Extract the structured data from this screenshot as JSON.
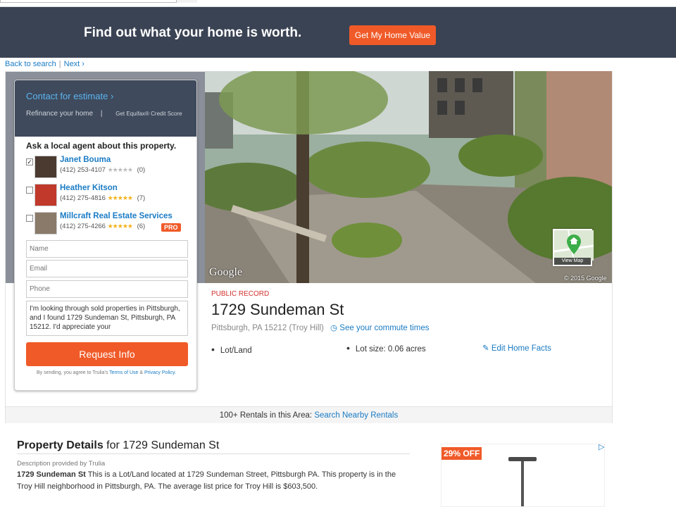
{
  "banner": {
    "message": "Find out what your home is worth.",
    "cta": "Get My Home Value"
  },
  "nav": {
    "back": "Back to search",
    "separator": "|",
    "next": "Next ›"
  },
  "lead_form": {
    "contact": "Contact for estimate ›",
    "refinance": "Refinance your home",
    "divider": "|",
    "equifax": "Get Equifax® Credit Score",
    "ask": "Ask a local agent about this property.",
    "agents": [
      {
        "name": "Janet Bouma",
        "phone": "(412) 253-4107",
        "stars": "★★★★★",
        "count": "(0)",
        "checked": "✓"
      },
      {
        "name": "Heather Kitson",
        "phone": "(412) 275-4816",
        "stars": "★★★★★",
        "count": "(7)"
      },
      {
        "name": "Millcraft Real Estate Services",
        "phone": "(412) 275-4266",
        "stars": "★★★★★",
        "count": "(6)",
        "badge": "PRO"
      }
    ],
    "placeholders": {
      "name": "Name",
      "email": "Email",
      "phone": "Phone"
    },
    "message": "I'm looking through sold properties in Pittsburgh, and I found 1729 Sundeman St, Pittsburgh, PA 15212. I'd appreciate your",
    "submit": "Request Info",
    "terms_prefix": "By sending, you agree to Trulia's",
    "terms_link": "Terms of Use",
    "terms_and": "&",
    "privacy_link": "Privacy Policy."
  },
  "photo": {
    "google": "Google",
    "copyright": "© 2015 Google",
    "view_map": "View Map"
  },
  "property": {
    "status": "PUBLIC RECORD",
    "address": "1729 Sundeman St",
    "city": "Pittsburgh,",
    "state": "PA",
    "zip": "15212",
    "neighborhood": "(Troy Hill)",
    "commute": "See your commute times",
    "type": "Lot/Land",
    "lot_size": "Lot size: 0.06 acres",
    "edit": "Edit Home Facts"
  },
  "rentals": {
    "text": "100+ Rentals in this Area:",
    "link": "Search Nearby Rentals"
  },
  "details": {
    "title_bold": "Property Details",
    "title_rest": "for 1729 Sundeman St",
    "source": "Description provided by Trulia",
    "desc_bold": "1729 Sundeman St",
    "desc": "This is a Lot/Land located at 1729 Sundeman Street, Pittsburgh PA. This property is in the Troy Hill neighborhood in Pittsburgh, PA. The average list price for Troy Hill is $603,500."
  },
  "ad": {
    "discount": "29% OFF",
    "adchoice": "▷"
  },
  "colors": {
    "accent": "#f05a28",
    "link": "#1a7bc4",
    "banner": "#3a4354",
    "panel": "#3f4a5c"
  }
}
